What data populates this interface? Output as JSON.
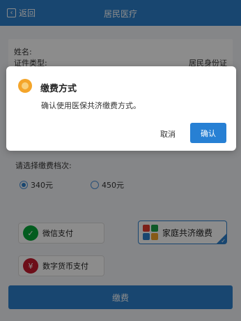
{
  "header": {
    "back_label": "返回",
    "title": "居民医疗"
  },
  "info": {
    "name_label": "姓名:",
    "name_value": "",
    "id_type_label": "证件类型:",
    "id_type_value": "居民身份证"
  },
  "tier": {
    "label": "请选择缴费档次:",
    "options": [
      {
        "label": "340元",
        "selected": true
      },
      {
        "label": "450元",
        "selected": false
      }
    ]
  },
  "payment_methods": [
    {
      "label": "微信支付",
      "icon": "wechat-pay-icon",
      "selected": false
    },
    {
      "label": "家庭共济缴费",
      "icon": "family-pay-icon",
      "selected": true
    },
    {
      "label": "数字货币支付",
      "icon": "digital-currency-icon",
      "selected": false
    }
  ],
  "pay_button": "缴费",
  "dialog": {
    "title": "缴费方式",
    "message": "确认使用医保共济缴费方式。",
    "cancel_label": "取消",
    "confirm_label": "确认"
  },
  "colors": {
    "primary": "#2c80cc",
    "warning_icon": "#f4a52a",
    "wechat": "#07a83a",
    "digital_currency": "#c71a2f"
  }
}
